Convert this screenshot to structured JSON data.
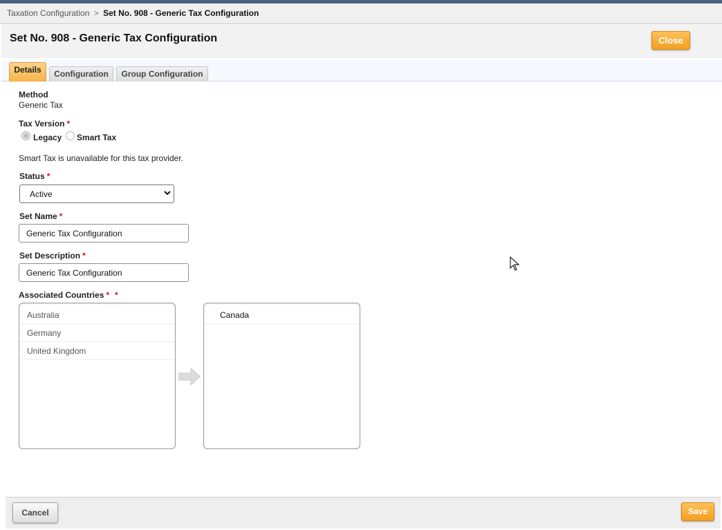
{
  "breadcrumb": {
    "parent": "Taxation Configuration",
    "separator": ">",
    "current": "Set No. 908 - Generic Tax Configuration"
  },
  "header": {
    "title": "Set No. 908 - Generic Tax Configuration",
    "close_label": "Close"
  },
  "tabs": [
    {
      "label": "Details",
      "active": true
    },
    {
      "label": "Configuration",
      "active": false
    },
    {
      "label": "Group Configuration",
      "active": false
    }
  ],
  "form": {
    "method_label": "Method",
    "method_value": "Generic Tax",
    "tax_version_label": "Tax Version",
    "required_mark": "*",
    "tax_version_options": [
      {
        "label": "Legacy",
        "checked": true,
        "disabled": true
      },
      {
        "label": "Smart Tax",
        "checked": false,
        "disabled": true
      }
    ],
    "smart_tax_note": "Smart Tax is unavailable for this tax provider.",
    "status_label": "Status",
    "status_value": "Active",
    "set_name_label": "Set Name",
    "set_name_value": "Generic Tax Configuration",
    "set_description_label": "Set Description",
    "set_description_value": "Generic Tax Configuration",
    "associated_countries_label": "Associated Countries",
    "available_countries": [
      "Australia",
      "Germany",
      "United Kingdom"
    ],
    "selected_countries": [
      "Canada"
    ]
  },
  "footer": {
    "cancel_label": "Cancel",
    "save_label": "Save"
  },
  "colors": {
    "accent_orange": "#f3a020",
    "required_red": "#dd1111",
    "top_bar": "#4a6180"
  },
  "icons": [
    "chevron-down-icon",
    "arrow-right-icon",
    "mouse-cursor-icon"
  ]
}
